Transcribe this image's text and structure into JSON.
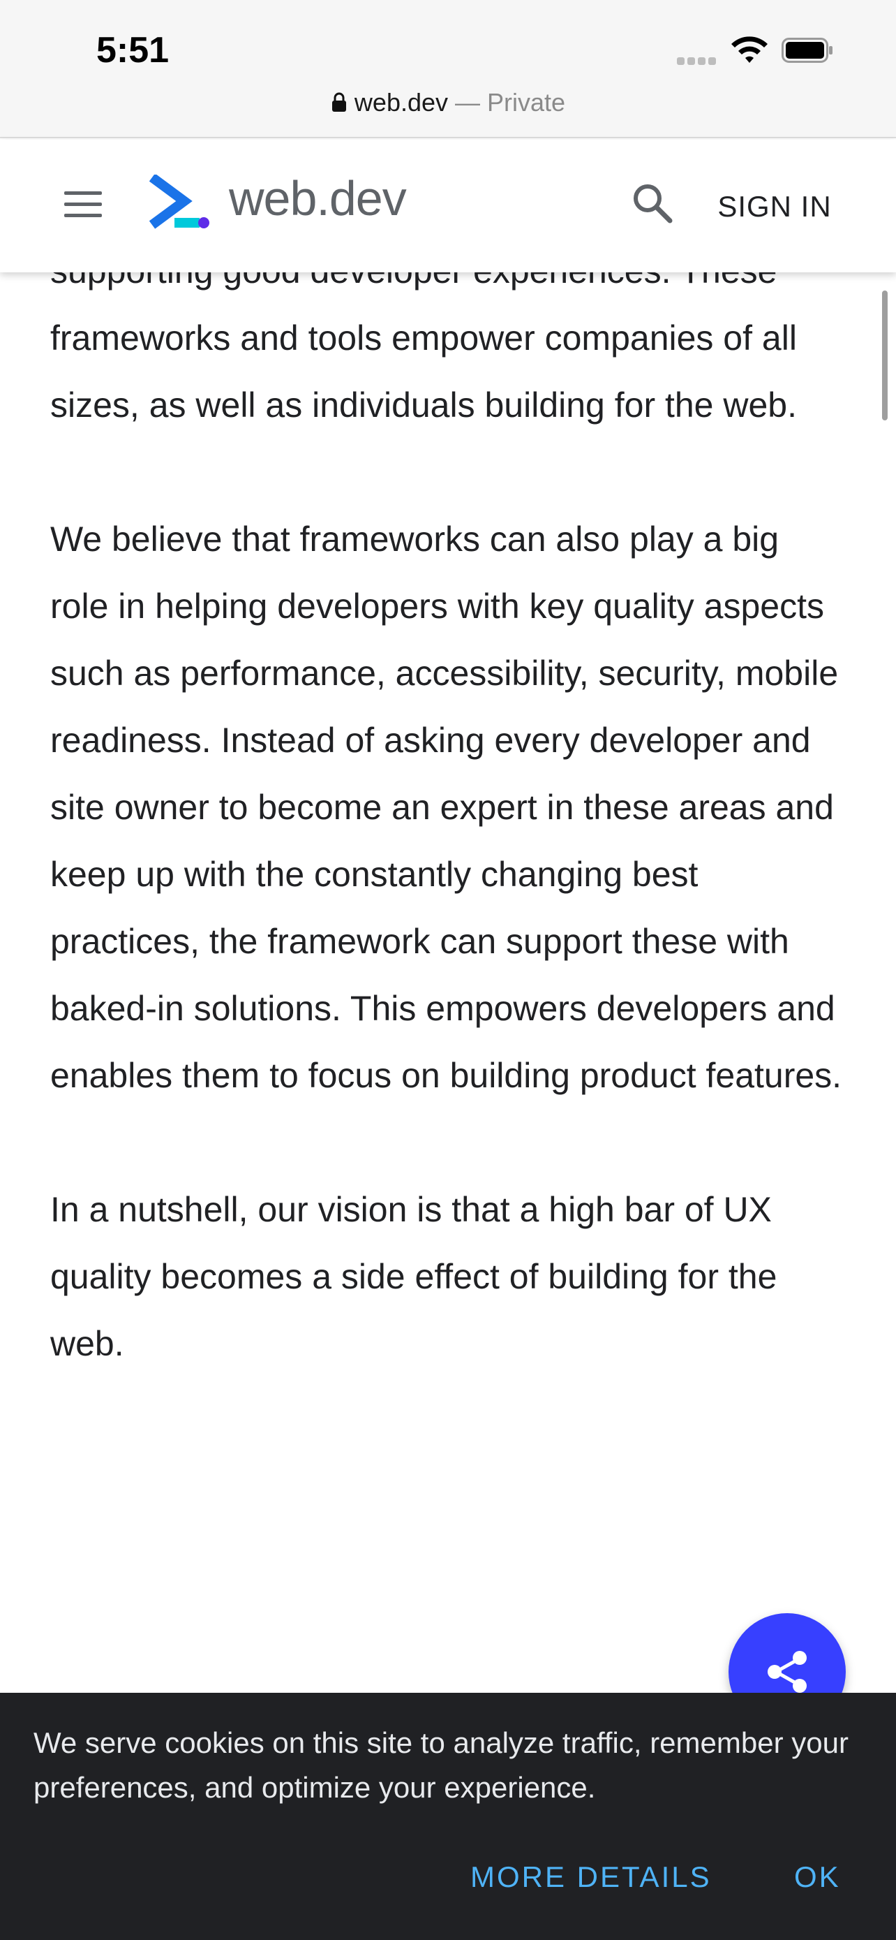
{
  "status_bar": {
    "time": "5:51"
  },
  "address_bar": {
    "domain": "web.dev",
    "separator": " — ",
    "mode": "Private"
  },
  "header": {
    "brand": "web.dev",
    "sign_in": "SIGN IN"
  },
  "article": {
    "partial_line": "supporting good developer experiences. These",
    "paragraph_1_rest": "frameworks and tools empower companies of all sizes, as well as individuals building for the web.",
    "paragraph_2": "We believe that frameworks can also play a big role in helping developers with key quality aspects such as performance, accessibility, security, mobile readiness. Instead of asking every developer and site owner to become an expert in these areas and keep up with the constantly changing best practices, the framework can support these with baked-in solutions. This empowers developers and enables them to focus on building product features.",
    "paragraph_3": "In a nutshell, our vision is that a high bar of UX quality becomes a side effect of building for the web."
  },
  "cookie_banner": {
    "text": "We serve cookies on this site to analyze traffic, remember your preferences, and optimize your experience.",
    "more_details": "MORE DETAILS",
    "ok": "OK"
  },
  "icons": {
    "menu": "hamburger-menu-icon",
    "logo": "web-dev-logo-icon",
    "search": "search-icon",
    "share": "share-icon",
    "lock": "lock-icon",
    "wifi": "wifi-icon",
    "battery": "battery-icon"
  },
  "colors": {
    "brand_blue": "#1a73e8",
    "fab_blue": "#3740ff",
    "cookie_bg": "#202124",
    "cookie_link": "#4fb3f6"
  }
}
